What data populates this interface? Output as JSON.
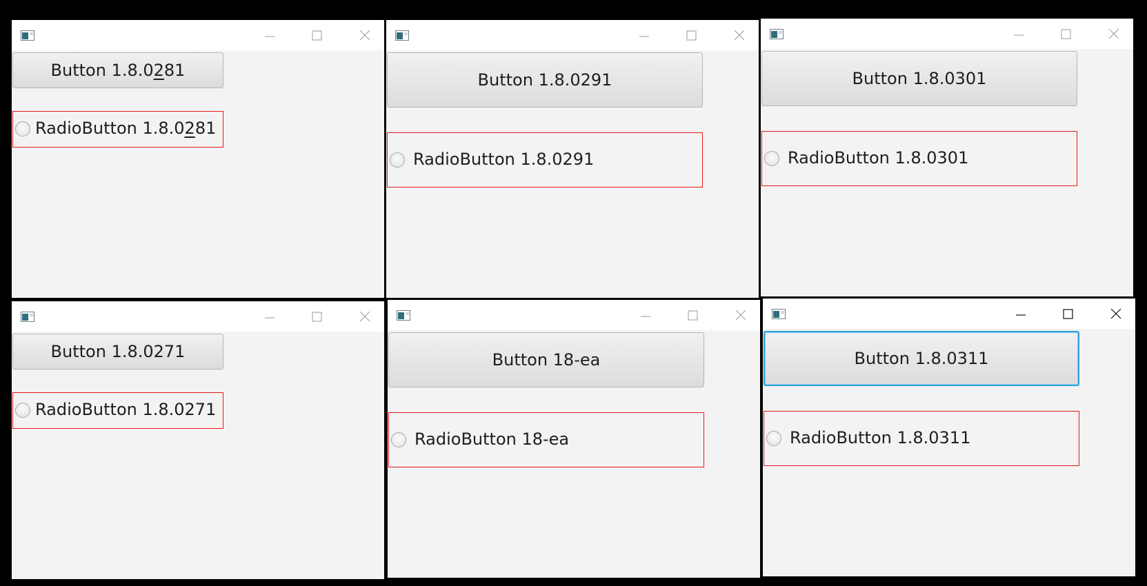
{
  "windows": [
    {
      "id": "w1",
      "button_prefix": "Button 1.8.0",
      "button_mnemonic": "2",
      "button_suffix": "81",
      "radio_prefix": "RadioButton 1.8.0",
      "radio_mnemonic": "2",
      "radio_suffix": "81"
    },
    {
      "id": "w2",
      "button_label": "Button 1.8.0291",
      "radio_label": "RadioButton 1.8.0291"
    },
    {
      "id": "w3",
      "button_label": "Button 1.8.0301",
      "radio_label": "RadioButton 1.8.0301"
    },
    {
      "id": "w4",
      "button_label": "Button 1.8.0271",
      "radio_label": "RadioButton 1.8.0271"
    },
    {
      "id": "w5",
      "button_label": "Button 18-ea",
      "radio_label": "RadioButton 18-ea"
    },
    {
      "id": "w6",
      "button_label": "Button 1.8.0311",
      "radio_label": "RadioButton 1.8.0311",
      "button_focused": true
    }
  ],
  "colors": {
    "screen_background": "#000000",
    "window_background": "#f3f3f3",
    "titlebar_background": "#ffffff",
    "highlight_border": "#e11a1a",
    "focus_border": "#2ba3d8"
  },
  "icons": {
    "app": "java-app-icon",
    "minimize": "minimize-icon",
    "maximize": "maximize-icon",
    "close": "close-icon"
  }
}
